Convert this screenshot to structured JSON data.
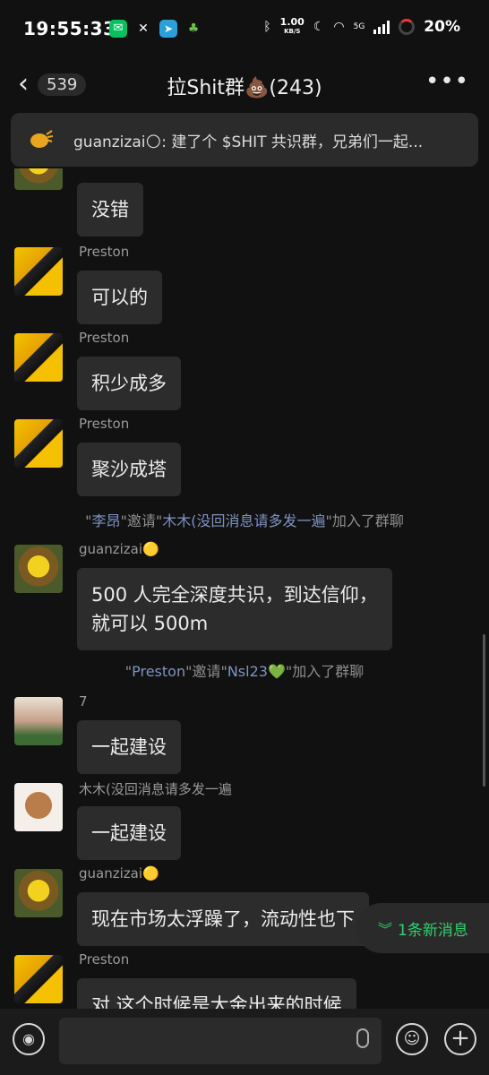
{
  "status_bar": {
    "time": "19:55:33",
    "speed_value": "1.00",
    "speed_unit": "KB/S",
    "network": "5G",
    "battery": "20%"
  },
  "header": {
    "back_count": "539",
    "title": "拉Shit群💩(243)"
  },
  "pinned": {
    "text": "guanzizai🌕: 建了个 $SHIT 共识群，兄弟们一起..."
  },
  "messages": [
    {
      "sender": "",
      "text": "没错"
    },
    {
      "sender": "Preston",
      "text": "可以的"
    },
    {
      "sender": "Preston",
      "text": "积少成多"
    },
    {
      "sender": "Preston",
      "text": "聚沙成塔"
    },
    {
      "sender": "guanzizai🟡",
      "text_line1": "500 人完全深度共识，到达信仰，",
      "text_line2": "就可以 500m"
    },
    {
      "sender": "7",
      "text": "一起建设"
    },
    {
      "sender": "木木(没回消息请多发一遍",
      "text": "一起建设"
    },
    {
      "sender": "guanzizai🟡",
      "text": "现在市场太浮躁了，流动性也下"
    },
    {
      "sender": "Preston",
      "text": "对 这个时候是大金出来的时候"
    }
  ],
  "system": [
    {
      "q1": "\"",
      "a": "李昂",
      "q2": "\"邀请\"",
      "b": "木木(没回消息请多发一遍",
      "tail": "\"加入了群聊"
    },
    {
      "q1": "\"",
      "a": "Preston",
      "q2": "\"邀请\"",
      "b": "Nsl23💚",
      "tail": "\"加入了群聊"
    }
  ],
  "new_messages": {
    "label": "1条新消息"
  },
  "colors": {
    "background": "#111111",
    "bubble": "#2c2c2c",
    "accent_green": "#2bd36b",
    "system_name": "#7f93c2"
  }
}
